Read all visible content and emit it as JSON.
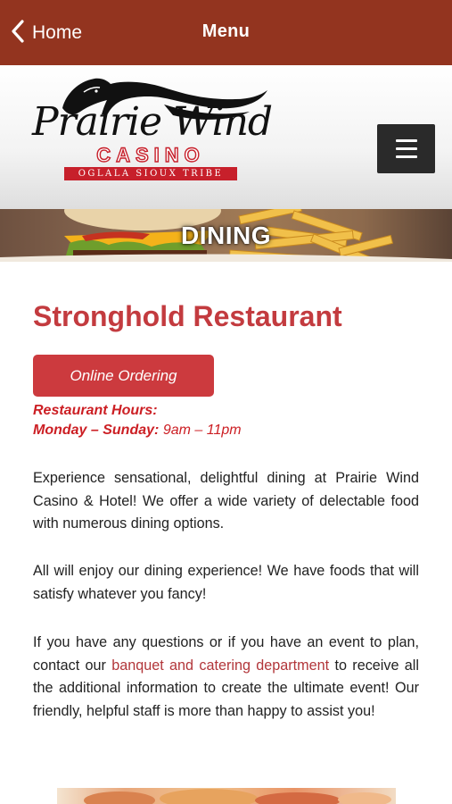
{
  "nav": {
    "back_label": "Home",
    "title": "Menu"
  },
  "header": {
    "logo": {
      "name": "Prairie Wind",
      "casino": "CASINO",
      "tribe": "OGLALA SIOUX TRIBE"
    }
  },
  "banner": {
    "title": "DINING"
  },
  "content": {
    "restaurant_title": "Stronghold Restaurant",
    "order_button_label": "Online Ordering",
    "hours_heading": "Restaurant Hours:",
    "hours_days": "Monday – Sunday:",
    "hours_time": "9am – 11pm",
    "paragraph_1": "Experience sensational, delightful dining at Prairie Wind Casino & Hotel! We offer a wide variety of delectable food with numerous dining options.",
    "paragraph_2": "All will enjoy our dining experience! We have foods that will satisfy whatever you fancy!",
    "paragraph_3_before": "If you have any questions or if you have an event to plan, contact our ",
    "paragraph_3_link": "banquet and catering department",
    "paragraph_3_after": " to receive all the additional information to create the ultimate event! Our friendly, helpful staff is more than happy to assist you!"
  },
  "colors": {
    "nav_bar": "#93341f",
    "accent_red": "#c33b3f",
    "hours_red": "#cc1f24",
    "link": "#b2363a",
    "menu_button": "#2a2a2a"
  },
  "icons": {
    "back": "chevron-left-icon",
    "menu": "hamburger-icon"
  }
}
